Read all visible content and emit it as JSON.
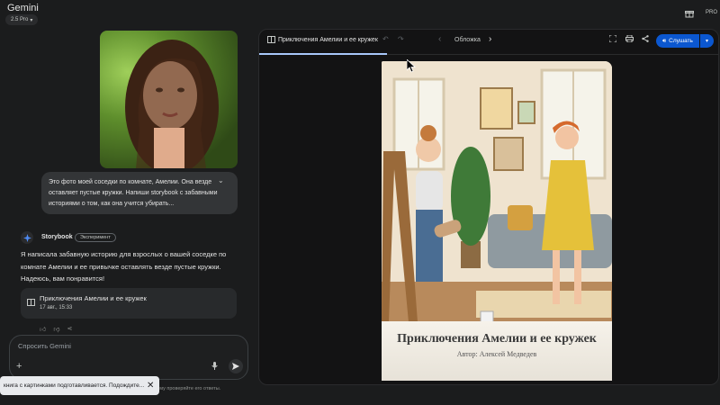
{
  "app": {
    "title": "Gemini",
    "model": "2.5 Pro",
    "pro_label": "PRO"
  },
  "chat": {
    "user_message": "Это фото моей соседки по комнате, Амелии. Она везде оставляет пустые кружки. Напиши storybook с забавными историями о том, как она учится убирать...",
    "agent": {
      "name": "Storybook",
      "badge": "Эксперимент"
    },
    "reply": "Я написала забавную историю для взрослых о вашей соседке по комнате Амелии и ее привычке оставлять везде пустые кружки. Надеюсь, вам понравится!",
    "card": {
      "title": "Приключения Амелии и ее кружек",
      "date": "17 авг., 15:33"
    },
    "input_placeholder": "Спросить Gemini",
    "disclaimer": "Gemini может ошибаться, поэтому проверяйте его ответы."
  },
  "toast": {
    "text": "книга с картинками подготавливается. Подождите..."
  },
  "panel": {
    "title": "Приключения Амелии и ее кружек",
    "page_label": "Обложка",
    "listen_label": "Слушать"
  },
  "cover": {
    "title": "Приключения Амелии и ее кружек",
    "author": "Автор: Алексей Медведев"
  },
  "colors": {
    "accent": "#0b57d0",
    "background": "#1b1c1d",
    "panel": "#131314"
  }
}
